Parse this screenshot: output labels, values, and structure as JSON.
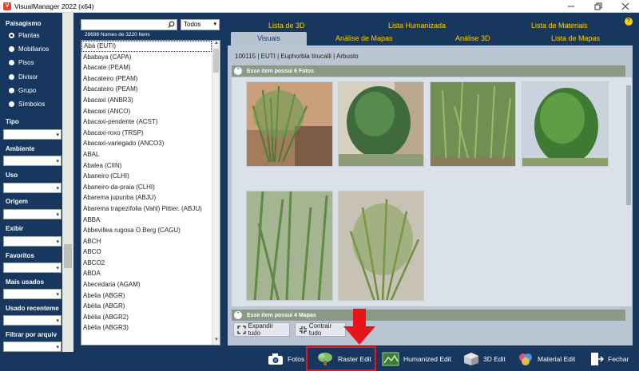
{
  "window": {
    "title": "VisualManager 2022 (x64)"
  },
  "sidebar": {
    "category_heading": "Paisagismo",
    "categories": [
      {
        "label": "Plantas",
        "selected": true
      },
      {
        "label": "Mobiliarios",
        "selected": false
      },
      {
        "label": "Pisos",
        "selected": false
      },
      {
        "label": "Divisor",
        "selected": false
      },
      {
        "label": "Grupo",
        "selected": false
      },
      {
        "label": "Símbolos",
        "selected": false
      }
    ],
    "filters": [
      {
        "label": "Tipo"
      },
      {
        "label": "Ambiente"
      },
      {
        "label": "Uso"
      },
      {
        "label": "Origem"
      },
      {
        "label": "Exibir"
      },
      {
        "label": "Favoritos"
      },
      {
        "label": "Mais usados"
      },
      {
        "label": "Usado recenteme"
      },
      {
        "label": "Filtrar por arquiv"
      }
    ]
  },
  "list": {
    "search_value": "",
    "filter_value": "Todos",
    "count_text": "28698 Nomes de 3220 Itens",
    "items": [
      "Abá (EUTI)",
      "Ababaya (CAPA)",
      "Abacate (PEAM)",
      "Abacateiro (PEAM)",
      "Abacateiro (PEAM)",
      "Abacaxi (ANBR3)",
      "Abacaxi (ANCO)",
      "Abacaxi-pendente (ACST)",
      "Abacaxi-roxo (TRSP)",
      "Abacaxi-variegado (ANCO3)",
      "ABAL",
      "Abalea (CIIN)",
      "Abaneiro (CLHI)",
      "Abaneiro-da-praia (CLHI)",
      "Abarema jupunba (ABJU)",
      "Abarema trapezifolia (Vahl) Pittier. (ABJU)",
      "ABBA",
      "Abbevillea rugosa O.Berg (CAGU)",
      "ABCH",
      "ABCO",
      "ABCO2",
      "ABDA",
      "Abecedaria (AGAM)",
      "Abelia (ABGR)",
      "Abélia (ABGR)",
      "Abélia (ABGR2)",
      "Abélia (ABGR3)"
    ]
  },
  "tabs": {
    "top": [
      "Lista de 3D",
      "Lista Humanizada",
      "Lista de Materiais"
    ],
    "bottom": [
      "Visuais",
      "Análise de Mapas",
      "Análise 3D",
      "Lista de Mapas"
    ],
    "active": "Visuais"
  },
  "content": {
    "path": "100115 | EUTI | Euphorbia tirucalli | Arbusto",
    "photos_section": "Esse item possui  6 Fotos",
    "maps_section": "Esse item possui  4 Mapas",
    "expand_label": "Expandir tudo",
    "collapse_label": "Contrair tudo"
  },
  "toolbar": {
    "fotos": "Fotos",
    "raster": "Raster Edit",
    "humanized": "Humanized Edit",
    "edit3d": "3D Edit",
    "material": "Material Edit",
    "close": "Fechar"
  },
  "colors": {
    "accent_tab": "#ffd200",
    "background": "#17375e",
    "highlight": "#e8141b"
  }
}
